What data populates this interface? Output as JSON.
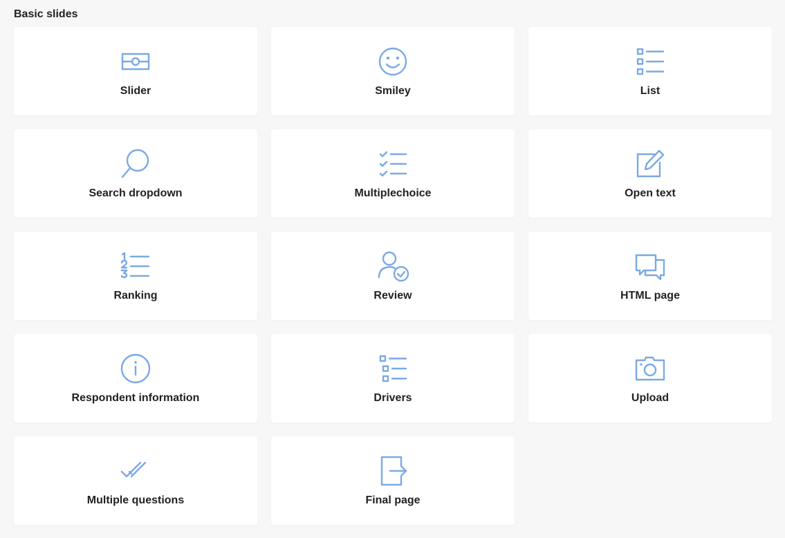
{
  "section": {
    "title": "Basic slides"
  },
  "accent_color": "#7aa9e3",
  "cards": [
    {
      "label": "Slider",
      "icon": "slider-icon"
    },
    {
      "label": "Smiley",
      "icon": "smiley-icon"
    },
    {
      "label": "List",
      "icon": "list-icon"
    },
    {
      "label": "Search dropdown",
      "icon": "search-icon"
    },
    {
      "label": "Multiplechoice",
      "icon": "checklist-icon"
    },
    {
      "label": "Open text",
      "icon": "edit-icon"
    },
    {
      "label": "Ranking",
      "icon": "numbered-list-icon"
    },
    {
      "label": "Review",
      "icon": "user-check-icon"
    },
    {
      "label": "HTML page",
      "icon": "chat-bubbles-icon"
    },
    {
      "label": "Respondent information",
      "icon": "info-icon"
    },
    {
      "label": "Drivers",
      "icon": "drivers-list-icon"
    },
    {
      "label": "Upload",
      "icon": "camera-icon"
    },
    {
      "label": "Multiple questions",
      "icon": "double-check-icon"
    },
    {
      "label": "Final page",
      "icon": "exit-icon"
    }
  ]
}
